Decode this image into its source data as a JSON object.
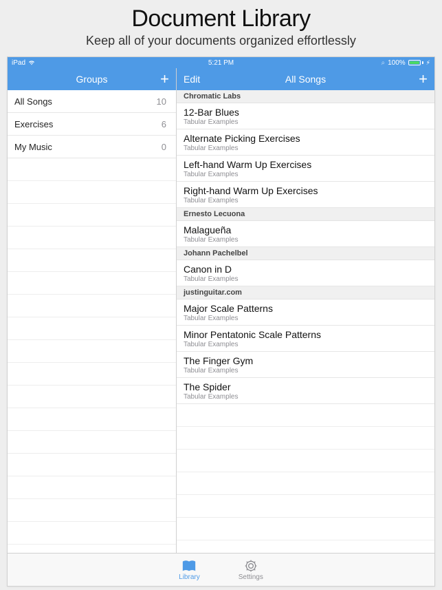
{
  "page": {
    "title": "Document Library",
    "subtitle": "Keep all of your documents organized effortlessly"
  },
  "statusbar": {
    "carrier": "iPad",
    "time": "5:21 PM",
    "battery_pct": "100%"
  },
  "sidebar": {
    "title": "Groups",
    "items": [
      {
        "label": "All Songs",
        "count": "10"
      },
      {
        "label": "Exercises",
        "count": "6"
      },
      {
        "label": "My Music",
        "count": "0"
      }
    ]
  },
  "main": {
    "edit_label": "Edit",
    "title": "All Songs",
    "sections": [
      {
        "header": "Chromatic Labs",
        "songs": [
          {
            "title": "12-Bar Blues",
            "sub": "Tabular Examples"
          },
          {
            "title": "Alternate Picking Exercises",
            "sub": "Tabular Examples"
          },
          {
            "title": "Left-hand Warm Up Exercises",
            "sub": "Tabular Examples"
          },
          {
            "title": "Right-hand Warm Up Exercises",
            "sub": "Tabular Examples"
          }
        ]
      },
      {
        "header": "Ernesto Lecuona",
        "songs": [
          {
            "title": "Malagueña",
            "sub": "Tabular Examples"
          }
        ]
      },
      {
        "header": "Johann Pachelbel",
        "songs": [
          {
            "title": "Canon in D",
            "sub": "Tabular Examples"
          }
        ]
      },
      {
        "header": "justinguitar.com",
        "songs": [
          {
            "title": "Major Scale Patterns",
            "sub": "Tabular Examples"
          },
          {
            "title": "Minor Pentatonic Scale Patterns",
            "sub": "Tabular Examples"
          },
          {
            "title": "The Finger Gym",
            "sub": "Tabular Examples"
          },
          {
            "title": "The Spider",
            "sub": "Tabular Examples"
          }
        ]
      }
    ]
  },
  "tabbar": {
    "library_label": "Library",
    "settings_label": "Settings"
  }
}
